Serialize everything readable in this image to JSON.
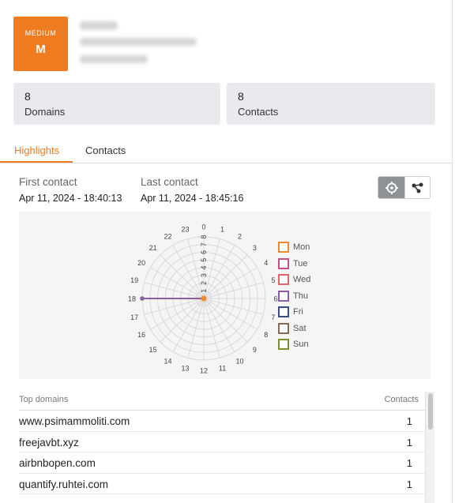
{
  "header": {
    "severity_level": "MEDIUM",
    "severity_letter": "M",
    "severity_color": "#f07c22"
  },
  "stats": [
    {
      "value": "8",
      "label": "Domains"
    },
    {
      "value": "8",
      "label": "Contacts"
    }
  ],
  "tabs": [
    {
      "label": "Highlights",
      "active": true
    },
    {
      "label": "Contacts",
      "active": false
    }
  ],
  "contact": {
    "first_label": "First contact",
    "first_value": "Apr 11, 2024 - 18:40:13",
    "last_label": "Last contact",
    "last_value": "Apr 11, 2024 - 18:45:16"
  },
  "view_toggle": {
    "selected": "crosshair-icon",
    "other": "graph-icon"
  },
  "chart_data": {
    "type": "radar",
    "angular_categories": [
      "0",
      "1",
      "2",
      "3",
      "4",
      "5",
      "6",
      "7",
      "8",
      "9",
      "10",
      "11",
      "12",
      "13",
      "14",
      "15",
      "16",
      "17",
      "18",
      "19",
      "20",
      "21",
      "22",
      "23"
    ],
    "radial_ticks": [
      "1",
      "2",
      "3",
      "4",
      "5",
      "6",
      "7",
      "8"
    ],
    "rlim": [
      0,
      8
    ],
    "series": [
      {
        "name": "Mon",
        "color": "#f08a2a",
        "values": [
          0,
          0,
          0,
          0,
          0,
          0,
          0,
          0,
          0,
          0,
          0,
          0,
          0,
          0,
          0,
          0,
          0,
          0,
          0,
          0,
          0,
          0,
          0,
          0
        ]
      },
      {
        "name": "Tue",
        "color": "#c94f86",
        "values": [
          0,
          0,
          0,
          0,
          0,
          0,
          0,
          0,
          0,
          0,
          0,
          0,
          0,
          0,
          0,
          0,
          0,
          0,
          0,
          0,
          0,
          0,
          0,
          0
        ]
      },
      {
        "name": "Wed",
        "color": "#e6646e",
        "values": [
          0,
          0,
          0,
          0,
          0,
          0,
          0,
          0,
          0,
          0,
          0,
          0,
          0,
          0,
          0,
          0,
          0,
          0,
          0,
          0,
          0,
          0,
          0,
          0
        ]
      },
      {
        "name": "Thu",
        "color": "#8b5fa3",
        "values": [
          0,
          0,
          0,
          0,
          0,
          0,
          0,
          0,
          0,
          0,
          0,
          0,
          0,
          0,
          0,
          0,
          0,
          0,
          8,
          0,
          0,
          0,
          0,
          0
        ]
      },
      {
        "name": "Fri",
        "color": "#3f4c82",
        "values": [
          0,
          0,
          0,
          0,
          0,
          0,
          0,
          0,
          0,
          0,
          0,
          0,
          0,
          0,
          0,
          0,
          0,
          0,
          0,
          0,
          0,
          0,
          0,
          0
        ]
      },
      {
        "name": "Sat",
        "color": "#8a6a55",
        "values": [
          0,
          0,
          0,
          0,
          0,
          0,
          0,
          0,
          0,
          0,
          0,
          0,
          0,
          0,
          0,
          0,
          0,
          0,
          0,
          0,
          0,
          0,
          0,
          0
        ]
      },
      {
        "name": "Sun",
        "color": "#7b8f2a",
        "values": [
          0,
          0,
          0,
          0,
          0,
          0,
          0,
          0,
          0,
          0,
          0,
          0,
          0,
          0,
          0,
          0,
          0,
          0,
          0,
          0,
          0,
          0,
          0,
          0
        ]
      }
    ],
    "legend_position": "right",
    "grid": true
  },
  "top_domains": {
    "col_domain": "Top domains",
    "col_contacts": "Contacts",
    "rows": [
      {
        "domain": "www.psimammoliti.com",
        "contacts": "1"
      },
      {
        "domain": "freejavbt.xyz",
        "contacts": "1"
      },
      {
        "domain": "airbnbopen.com",
        "contacts": "1"
      },
      {
        "domain": "quantify.ruhtei.com",
        "contacts": "1"
      }
    ]
  }
}
